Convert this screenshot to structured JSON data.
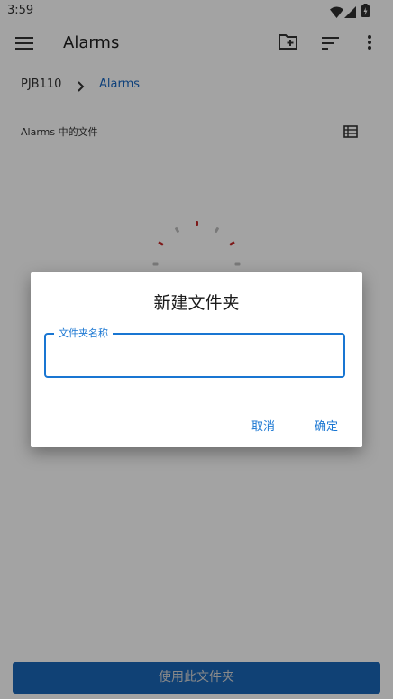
{
  "status_bar": {
    "time": "3:59"
  },
  "app_bar": {
    "title": "Alarms",
    "icons": [
      "menu-icon",
      "new-folder-icon",
      "sort-icon",
      "more-vert-icon"
    ]
  },
  "breadcrumb": {
    "root": "PJB110",
    "separator_icon": "chevron-right-icon",
    "current": "Alarms"
  },
  "section": {
    "label": "Alarms 中的文件",
    "view_icon": "list-view-icon"
  },
  "dialog": {
    "title": "新建文件夹",
    "field": {
      "label": "文件夹名称",
      "value": ""
    },
    "cancel_label": "取消",
    "ok_label": "确定"
  },
  "bottom_button": {
    "label": "使用此文件夹"
  },
  "colors": {
    "accent": "#1976d2",
    "bottom_button": "#1a66b8",
    "spinner_active": "#c62828"
  }
}
